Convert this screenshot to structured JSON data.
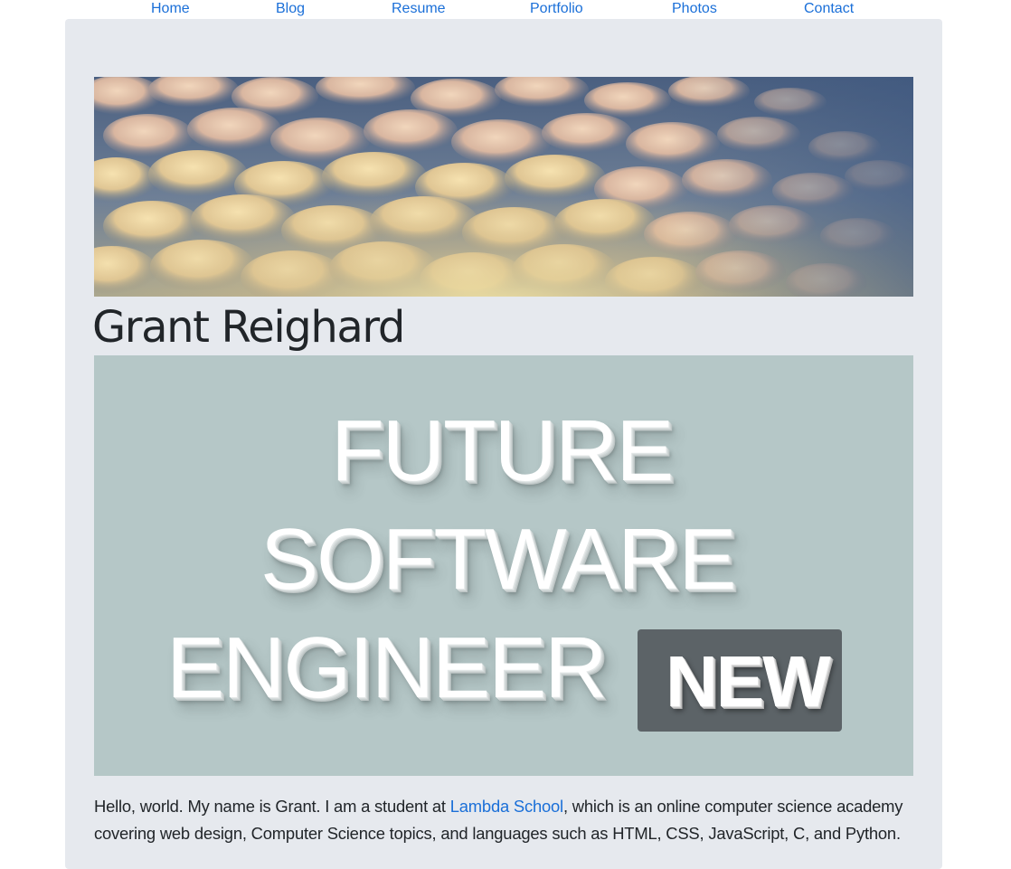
{
  "nav": {
    "items": [
      {
        "label": "Home"
      },
      {
        "label": "Blog"
      },
      {
        "label": "Resume"
      },
      {
        "label": "Portfolio"
      },
      {
        "label": "Photos"
      },
      {
        "label": "Contact"
      }
    ]
  },
  "hero": {
    "image_subject": "mammatus-clouds-sky-photo"
  },
  "header": {
    "name": "Grant Reighard"
  },
  "banner": {
    "line1": "FUTURE",
    "line2": "SOFTWARE",
    "line3": "ENGINEER",
    "badge": "NEW",
    "background": "#b5c7c7",
    "badge_color": "#5c6367"
  },
  "intro": {
    "before_link": "Hello, world. My name is Grant. I am a student at ",
    "link_text": "Lambda School",
    "after_link": ", which is an online computer science academy covering web design, Computer Science topics, and languages such as HTML, CSS, JavaScript, C, and Python."
  },
  "colors": {
    "link": "#1a6fd8",
    "container_bg": "#e6e9ee",
    "text": "#212529"
  }
}
